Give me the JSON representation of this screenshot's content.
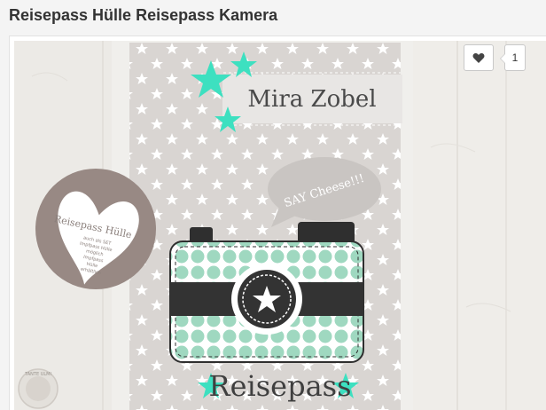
{
  "page": {
    "title": "Reisepass Hülle Reisepass Kamera"
  },
  "like": {
    "icon": "heart-icon",
    "count": "1"
  },
  "image": {
    "name_text": "Mira Zobel",
    "bubble_text": "SAY Cheese!!!",
    "product_text": "Reisepass",
    "badge_title": "Reisepass Hülle",
    "badge_lines": [
      "auch als SET",
      "Impfpass Hülle",
      "möglich",
      "Impfpass",
      "Hülle",
      "erhältlich"
    ],
    "stamp_text": "TANTE ULMI"
  },
  "colors": {
    "accent": "#3de0c0",
    "card": "#d6d2cf",
    "camera_mint": "#a8dcc6",
    "dark": "#333333",
    "badge": "#9a8b86"
  }
}
